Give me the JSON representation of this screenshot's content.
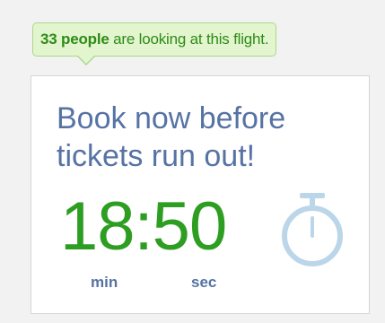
{
  "tooltip": {
    "count_text": "33 people",
    "rest_text": " are looking at this flight."
  },
  "card": {
    "headline": "Book now before tickets run out!",
    "timer": {
      "minutes": "18",
      "separator": ":",
      "seconds": "50",
      "min_label": "min",
      "sec_label": "sec"
    },
    "icon": "stopwatch-icon"
  },
  "colors": {
    "tooltip_bg": "#e3f5cf",
    "tooltip_border": "#a9d98a",
    "accent_green": "#2e9e22",
    "text_blue": "#5673a4",
    "icon_blue": "#bcd6e9"
  }
}
